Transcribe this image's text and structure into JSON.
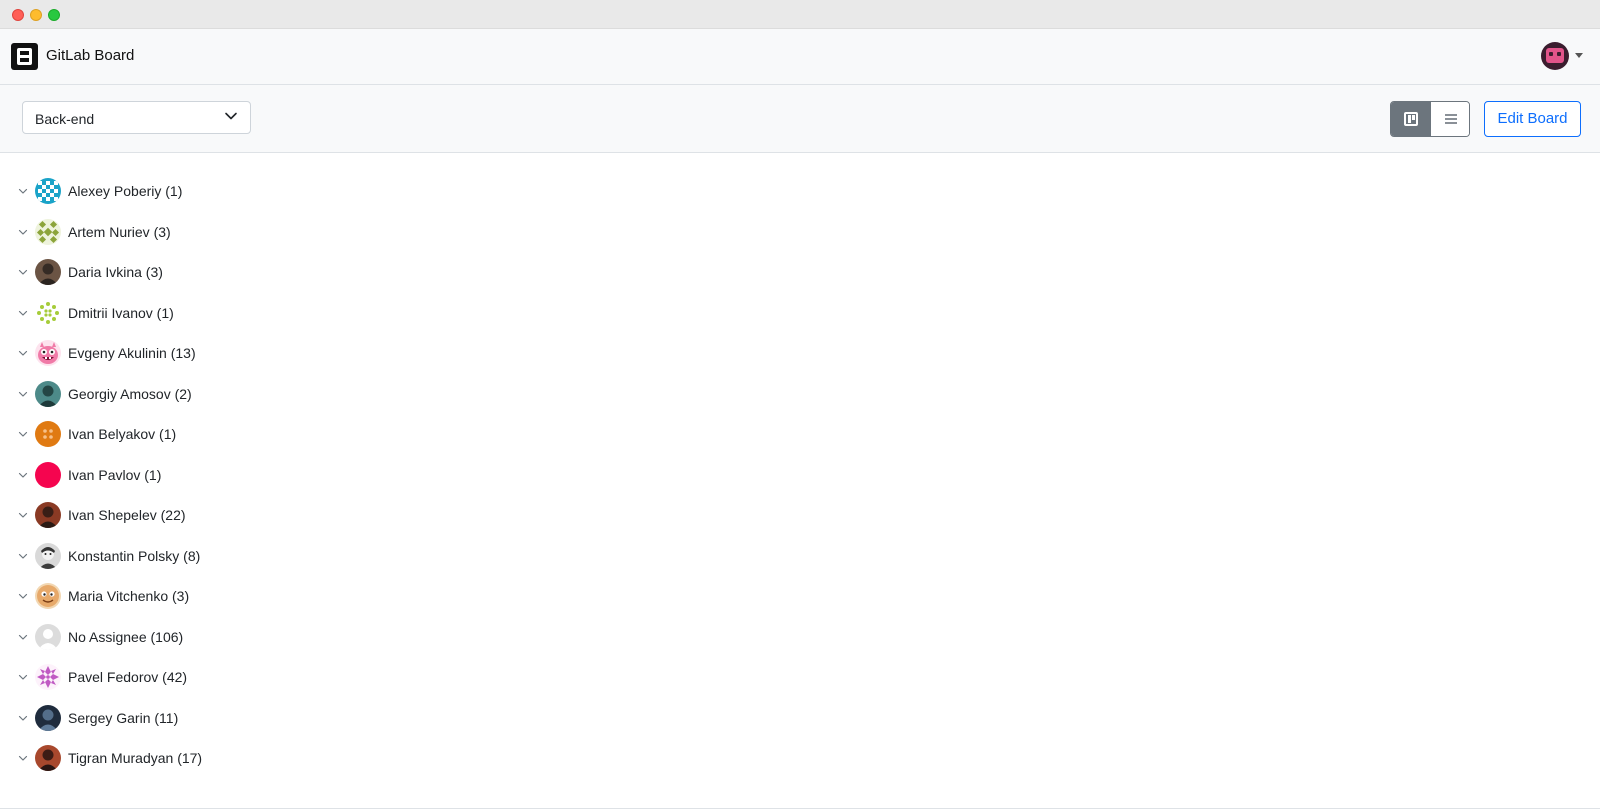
{
  "window": {
    "controls": [
      "close",
      "minimize",
      "maximize"
    ]
  },
  "navbar": {
    "logo_icon": "board-logo-icon",
    "title": "GitLab Board",
    "user_avatar_icon": "user-avatar-icon",
    "user_menu_icon": "caret-down-icon"
  },
  "toolbar": {
    "board_select": {
      "value": "Back-end",
      "icon": "chevron-down-icon"
    },
    "view_toggle": {
      "active": "board",
      "board_icon": "board-view-icon",
      "list_icon": "list-view-icon"
    },
    "edit_label": "Edit Board"
  },
  "assignees": [
    {
      "label": "Alexey Poberiy (1)",
      "avatar": "identicon-teal"
    },
    {
      "label": "Artem Nuriev (3)",
      "avatar": "identicon-olive"
    },
    {
      "label": "Daria Ivkina (3)",
      "avatar": "photo"
    },
    {
      "label": "Dmitrii Ivanov (1)",
      "avatar": "identicon-lime"
    },
    {
      "label": "Evgeny Akulinin (13)",
      "avatar": "cartoon-pink-monster"
    },
    {
      "label": "Georgiy Amosov (2)",
      "avatar": "photo"
    },
    {
      "label": "Ivan Belyakov (1)",
      "avatar": "identicon-orange"
    },
    {
      "label": "Ivan Pavlov (1)",
      "avatar": "solid-red"
    },
    {
      "label": "Ivan Shepelev (22)",
      "avatar": "photo"
    },
    {
      "label": "Konstantin Polsky (8)",
      "avatar": "photo-bw"
    },
    {
      "label": "Maria Vitchenko (3)",
      "avatar": "cartoon-face"
    },
    {
      "label": "No Assignee (106)",
      "avatar": "default-user"
    },
    {
      "label": "Pavel Fedorov (42)",
      "avatar": "identicon-purple"
    },
    {
      "label": "Sergey Garin (11)",
      "avatar": "photo"
    },
    {
      "label": "Tigran Muradyan (17)",
      "avatar": "photo"
    }
  ],
  "colors": {
    "accent": "#0d6efd",
    "toggle_active": "#6c757d",
    "navbar_bg": "#f8f9fa",
    "border": "#dee2e6"
  }
}
